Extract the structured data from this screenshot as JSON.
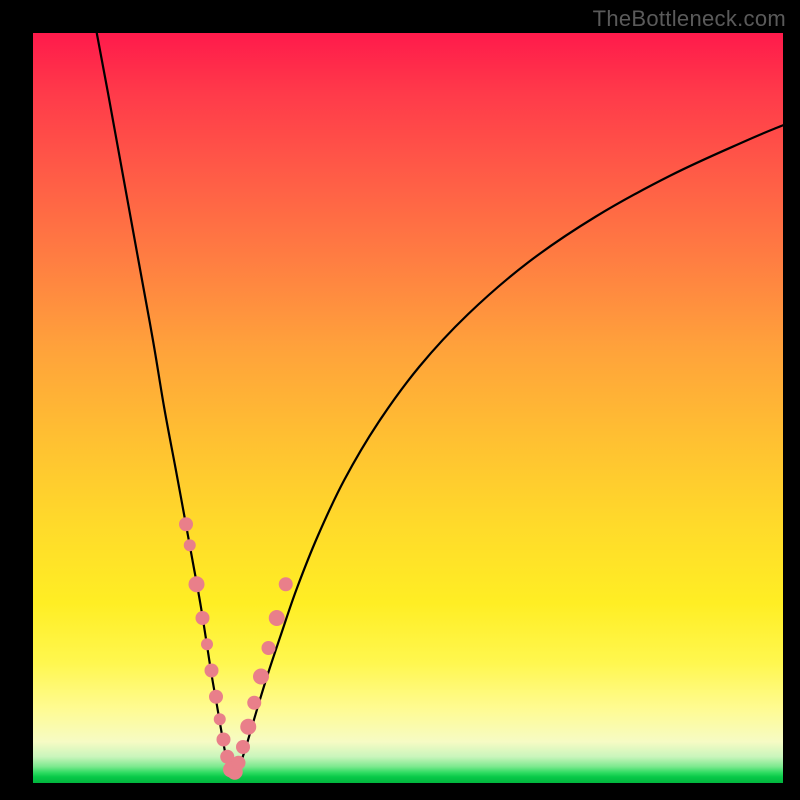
{
  "watermark": "TheBottleneck.com",
  "colors": {
    "frame": "#000000",
    "gradient_top": "#ff1a4b",
    "gradient_mid": "#ffee24",
    "gradient_bottom": "#02b53e",
    "curve": "#000000",
    "beads": "#e97f8a"
  },
  "chart_data": {
    "type": "line",
    "title": "",
    "xlabel": "",
    "ylabel": "",
    "x_range": [
      0,
      100
    ],
    "y_range": [
      0,
      100
    ],
    "note": "Axes are unlabeled. x/y expressed as percent of plot-area width/height with origin at top-left; y increases downward like the rendered image.",
    "series": [
      {
        "name": "left-branch",
        "x": [
          8.5,
          10.0,
          12.0,
          14.0,
          16.0,
          17.5,
          19.0,
          20.2,
          21.3,
          22.3,
          23.1,
          23.8,
          24.5,
          25.1,
          25.6,
          26.1,
          26.5
        ],
        "y": [
          0.0,
          8.0,
          19.0,
          30.0,
          41.0,
          50.0,
          58.0,
          64.5,
          70.5,
          76.0,
          81.0,
          85.5,
          89.5,
          93.0,
          95.8,
          97.7,
          98.8
        ]
      },
      {
        "name": "right-branch",
        "x": [
          27.0,
          27.6,
          28.3,
          29.1,
          30.1,
          31.4,
          33.1,
          35.2,
          38.0,
          41.5,
          46.0,
          51.5,
          58.0,
          66.0,
          75.0,
          85.0,
          95.0,
          100.0
        ],
        "y": [
          98.8,
          97.5,
          95.5,
          92.8,
          89.4,
          85.2,
          80.1,
          74.0,
          67.0,
          59.6,
          52.0,
          44.5,
          37.5,
          30.6,
          24.5,
          19.0,
          14.4,
          12.3
        ]
      }
    ],
    "markers": {
      "name": "beads",
      "x": [
        20.4,
        20.9,
        21.8,
        22.6,
        23.2,
        23.8,
        24.4,
        24.9,
        25.4,
        25.9,
        26.4,
        26.9,
        27.4,
        28.0,
        28.7,
        29.5,
        30.4,
        31.4,
        32.5,
        33.7
      ],
      "y": [
        65.5,
        68.3,
        73.5,
        78.0,
        81.5,
        85.0,
        88.5,
        91.5,
        94.2,
        96.5,
        98.2,
        98.5,
        97.3,
        95.2,
        92.5,
        89.3,
        85.8,
        82.0,
        78.0,
        73.5
      ],
      "r": [
        7,
        6,
        8,
        7,
        6,
        7,
        7,
        6,
        7,
        7,
        8,
        8,
        7,
        7,
        8,
        7,
        8,
        7,
        8,
        7
      ]
    }
  }
}
